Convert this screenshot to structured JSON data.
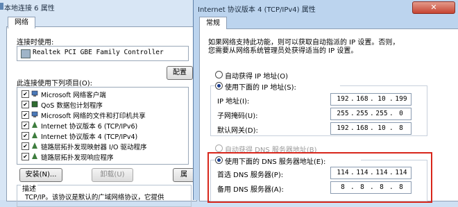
{
  "left_window": {
    "title": "本地连接 6 属性",
    "tab": "网络",
    "connect_using_label": "连接时使用:",
    "adapter": "Realtek PCI GBE Family Controller",
    "configure_button": "配置",
    "items_label": "此连接使用下列项目(O):",
    "items": [
      {
        "label": "Microsoft 网络客户端",
        "checked": true,
        "icon": "network-client-icon"
      },
      {
        "label": "QoS 数据包计划程序",
        "checked": true,
        "icon": "qos-icon"
      },
      {
        "label": "Microsoft 网络的文件和打印机共享",
        "checked": true,
        "icon": "file-share-icon"
      },
      {
        "label": "Internet 协议版本 6 (TCP/IPv6)",
        "checked": true,
        "icon": "protocol-icon"
      },
      {
        "label": "Internet 协议版本 4 (TCP/IPv4)",
        "checked": true,
        "icon": "protocol-icon"
      },
      {
        "label": "链路层拓扑发现映射器 I/O 驱动程序",
        "checked": true,
        "icon": "protocol-icon"
      },
      {
        "label": "链路层拓扑发现响应程序",
        "checked": true,
        "icon": "protocol-icon"
      }
    ],
    "install_button": "安装(N)...",
    "uninstall_button": "卸载(U)",
    "properties_button": "属",
    "description_label": "描述",
    "description_text": "TCP/IP。该协议是默认的广域网络协议，它提供"
  },
  "right_window": {
    "title": "Internet 协议版本 4 (TCP/IPv4) 属性",
    "tab": "常规",
    "intro_line1": "如果网络支持此功能，则可以获取自动指派的 IP 设置。否则，",
    "intro_line2": "您需要从网络系统管理员处获得适当的 IP 设置。",
    "auto_ip_label": "自动获得 IP 地址(O)",
    "manual_ip_label": "使用下面的 IP 地址(S):",
    "ip_label": "IP 地址(I):",
    "ip_value": [
      "192",
      "168",
      "10",
      "199"
    ],
    "mask_label": "子网掩码(U):",
    "mask_value": [
      "255",
      "255",
      "255",
      "0"
    ],
    "gateway_label": "默认网关(D):",
    "gateway_value": [
      "192",
      "168",
      "10",
      "8"
    ],
    "auto_dns_label": "自动获得 DNS 服务器地址(B)",
    "manual_dns_label": "使用下面的 DNS 服务器地址(E):",
    "dns1_label": "首选 DNS 服务器(P):",
    "dns1_value": [
      "114",
      "114",
      "114",
      "114"
    ],
    "dns2_label": "备用 DNS 服务器(A):",
    "dns2_value": [
      "8",
      "8",
      "8",
      "8"
    ],
    "close_button": "✕"
  },
  "colors": {
    "highlight_border": "#d8261b",
    "radio_dot": "#1a3d8f"
  }
}
